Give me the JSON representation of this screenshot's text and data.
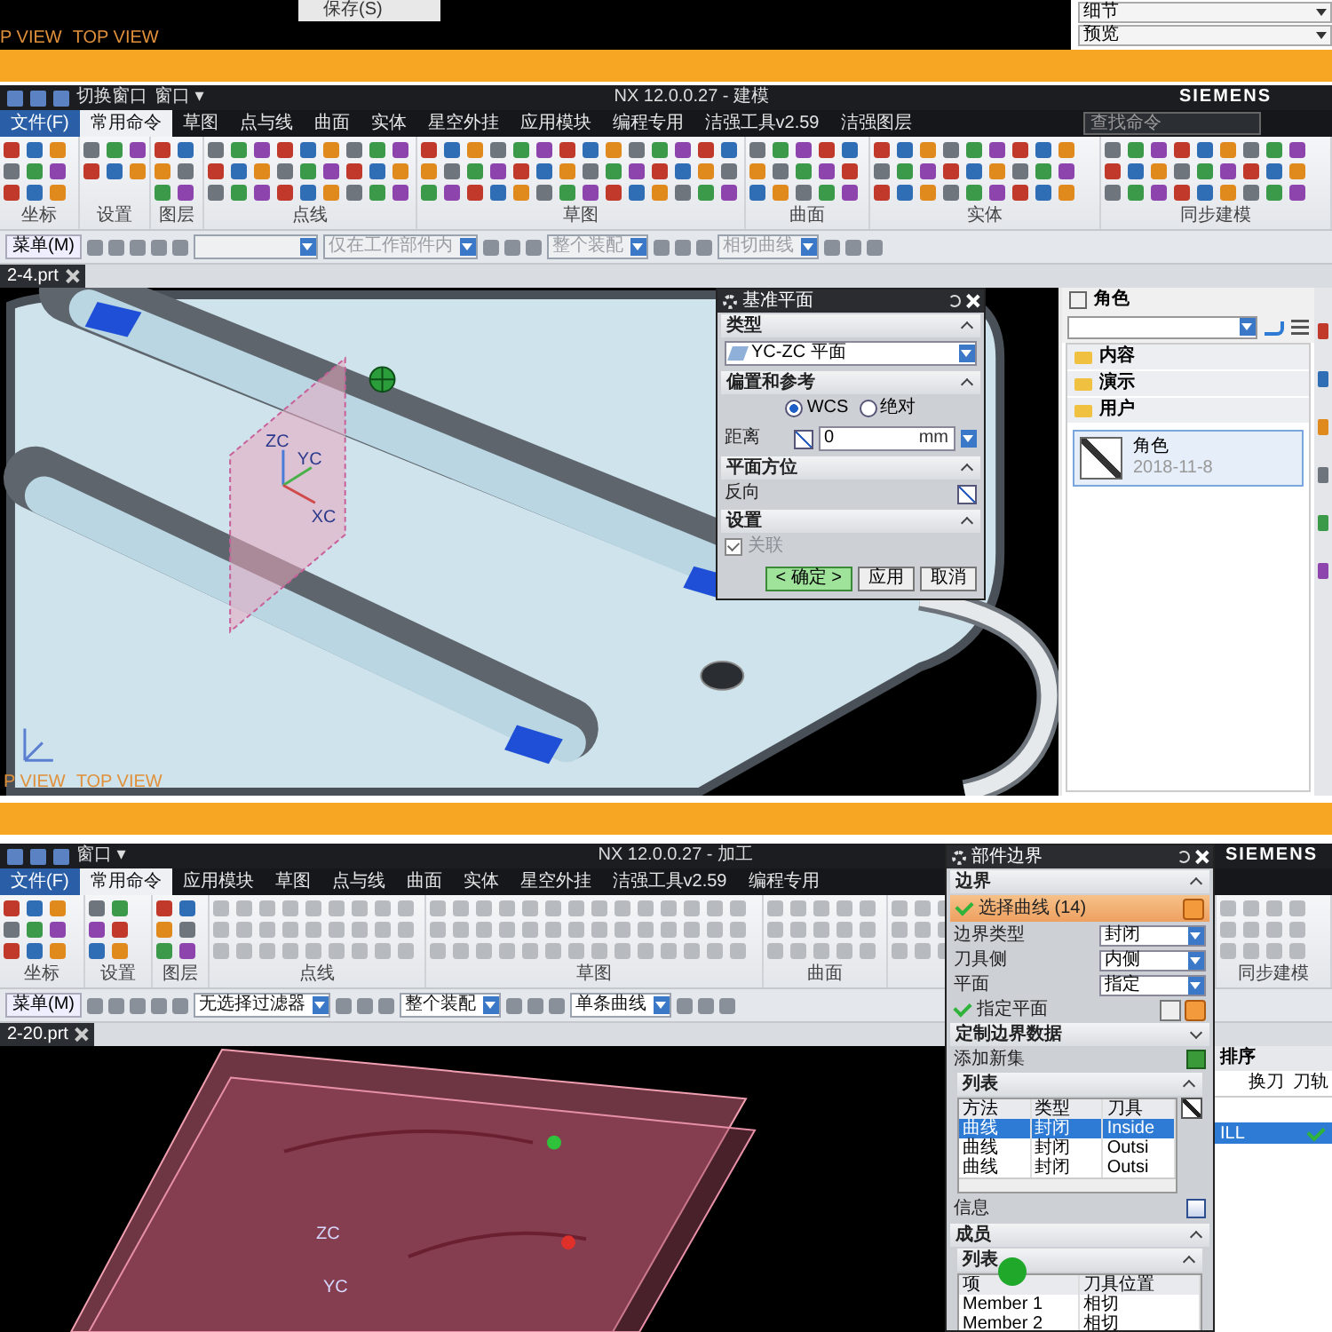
{
  "top_strip": {
    "context_menu_item": "保存(S)",
    "view_labels": [
      "P VIEW",
      "TOP VIEW"
    ],
    "panel_dropdowns": [
      "细节",
      "预览"
    ]
  },
  "modeling_window": {
    "quick_access": [
      "切换窗口",
      "窗口 ▾"
    ],
    "title": "NX 12.0.0.27 - 建模",
    "logo": "SIEMENS",
    "search": {
      "placeholder": "查找命令"
    },
    "tabs": [
      {
        "label": "文件(F)",
        "kind": "file",
        "selected": false
      },
      {
        "label": "常用命令",
        "kind": "tab",
        "selected": true
      },
      {
        "label": "草图",
        "kind": "tab",
        "selected": false
      },
      {
        "label": "点与线",
        "kind": "tab",
        "selected": false
      },
      {
        "label": "曲面",
        "kind": "tab",
        "selected": false
      },
      {
        "label": "实体",
        "kind": "tab",
        "selected": false
      },
      {
        "label": "星空外挂",
        "kind": "tab",
        "selected": false
      },
      {
        "label": "应用模块",
        "kind": "tab",
        "selected": false
      },
      {
        "label": "编程专用",
        "kind": "tab",
        "selected": false
      },
      {
        "label": "洁强工具v2.59",
        "kind": "tab",
        "selected": false
      },
      {
        "label": "洁强图层",
        "kind": "tab",
        "selected": false
      }
    ],
    "ribbon_groups": [
      {
        "label": "坐标",
        "disabled": false
      },
      {
        "label": "设置",
        "disabled": false
      },
      {
        "label": "图层",
        "disabled": false
      },
      {
        "label": "点线",
        "disabled": false
      },
      {
        "label": "草图",
        "disabled": false
      },
      {
        "label": "曲面",
        "disabled": false
      },
      {
        "label": "实体",
        "disabled": false
      },
      {
        "label": "同步建模",
        "disabled": false
      }
    ],
    "toolbar": {
      "menu": "菜单(M)",
      "dropdowns": [
        {
          "value": "仅在工作部件内",
          "disabled": true
        },
        {
          "value": "整个装配",
          "disabled": true
        },
        {
          "value": "相切曲线",
          "disabled": true
        }
      ]
    },
    "file_tab": "2-4.prt",
    "viewport": {
      "axis_labels": [
        "ZC",
        "YC",
        "XC"
      ],
      "view_labels": [
        "P VIEW",
        "TOP VIEW"
      ]
    },
    "dialog": {
      "title": "基准平面",
      "type_section": "类型",
      "type_value": "YC-ZC 平面",
      "offset_section": "偏置和参考",
      "references": [
        {
          "label": "WCS",
          "selected": true
        },
        {
          "label": "绝对",
          "selected": false
        }
      ],
      "distance": {
        "label": "距离",
        "value": "0",
        "unit": "mm"
      },
      "orientation_section": "平面方位",
      "reverse_label": "反向",
      "settings_section": "设置",
      "associative": {
        "label": "关联",
        "checked": true,
        "disabled": true
      },
      "buttons": [
        {
          "label": "< 确定 >",
          "default": true
        },
        {
          "label": "应用",
          "default": false
        },
        {
          "label": "取消",
          "default": false
        }
      ]
    },
    "role_panel": {
      "title": "角色",
      "folders": [
        "内容",
        "演示",
        "用户"
      ],
      "roles": [
        {
          "name": "角色",
          "date": "2018-11-8"
        }
      ]
    }
  },
  "machining_window": {
    "quick_access": [
      "窗口 ▾"
    ],
    "title": "NX 12.0.0.27 - 加工",
    "logo": "SIEMENS",
    "tabs": [
      {
        "label": "文件(F)",
        "kind": "file",
        "selected": false
      },
      {
        "label": "常用命令",
        "kind": "tab",
        "selected": true
      },
      {
        "label": "应用模块",
        "kind": "tab",
        "selected": false
      },
      {
        "label": "草图",
        "kind": "tab",
        "selected": false
      },
      {
        "label": "点与线",
        "kind": "tab",
        "selected": false
      },
      {
        "label": "曲面",
        "kind": "tab",
        "selected": false
      },
      {
        "label": "实体",
        "kind": "tab",
        "selected": false
      },
      {
        "label": "星空外挂",
        "kind": "tab",
        "selected": false
      },
      {
        "label": "洁强工具v2.59",
        "kind": "tab",
        "selected": false
      },
      {
        "label": "编程专用",
        "kind": "tab",
        "selected": false
      }
    ],
    "ribbon_groups": [
      {
        "label": "坐标",
        "disabled": false
      },
      {
        "label": "设置",
        "disabled": false
      },
      {
        "label": "图层",
        "disabled": false
      },
      {
        "label": "点线",
        "disabled": true
      },
      {
        "label": "草图",
        "disabled": true
      },
      {
        "label": "曲面",
        "disabled": true
      },
      {
        "disabled": true
      },
      {
        "label": "同步建模",
        "disabled": true
      }
    ],
    "toolbar": {
      "menu": "菜单(M)",
      "dropdowns": [
        {
          "value": "无选择过滤器",
          "disabled": false
        },
        {
          "value": "整个装配",
          "disabled": false
        },
        {
          "value": "单条曲线",
          "disabled": false
        }
      ]
    },
    "file_tab": "2-20.prt",
    "viewport": {
      "axis_labels": [
        "ZC",
        "YC"
      ]
    },
    "dialog": {
      "title": "部件边界",
      "boundary_section": "边界",
      "select_curve": "选择曲线 (14)",
      "fields": [
        {
          "label": "边界类型",
          "value": "封闭"
        },
        {
          "label": "刀具侧",
          "value": "内侧"
        },
        {
          "label": "平面",
          "value": "指定"
        }
      ],
      "specify_plane": "指定平面",
      "custom_section": "定制边界数据",
      "add_set": "添加新集",
      "list_section": "列表",
      "list_columns": [
        "方法",
        "类型",
        "刀具"
      ],
      "list_rows": [
        {
          "cells": [
            "曲线",
            "封闭",
            "Inside"
          ],
          "selected": true
        },
        {
          "cells": [
            "曲线",
            "封闭",
            "Outsi"
          ],
          "selected": false
        },
        {
          "cells": [
            "曲线",
            "封闭",
            "Outsi"
          ],
          "selected": false
        }
      ],
      "info_label": "信息",
      "members_section": "成员",
      "members_list_section": "列表",
      "member_columns": [
        "项",
        "刀具位置"
      ],
      "members": [
        [
          "Member 1",
          "相切"
        ],
        [
          "Member 2",
          "相切"
        ]
      ]
    },
    "navigator": {
      "header": "排序",
      "columns": [
        "换刀",
        "刀轨"
      ],
      "rows": [
        {
          "name": "ILL",
          "selected": true
        }
      ]
    }
  }
}
